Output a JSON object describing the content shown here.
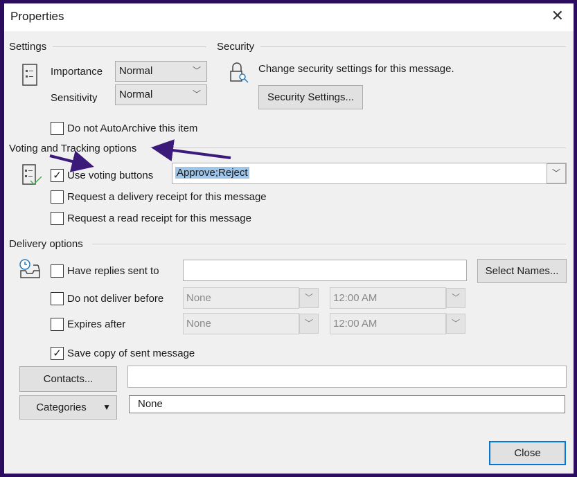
{
  "window": {
    "title": "Properties",
    "close_icon": "close-icon"
  },
  "settings": {
    "heading": "Settings",
    "importance_label": "Importance",
    "importance_value": "Normal",
    "sensitivity_label": "Sensitivity",
    "sensitivity_value": "Normal",
    "autoarchive_label": "Do not AutoArchive this item",
    "autoarchive_checked": false
  },
  "security": {
    "heading": "Security",
    "text": "Change security settings for this message.",
    "button": "Security Settings..."
  },
  "voting": {
    "heading": "Voting and Tracking options",
    "use_voting_label": "Use voting buttons",
    "use_voting_checked": true,
    "voting_value": "Approve;Reject",
    "delivery_receipt_label": "Request a delivery receipt for this message",
    "read_receipt_label": "Request a read receipt for this message"
  },
  "delivery": {
    "heading": "Delivery options",
    "replies_label": "Have replies sent to",
    "replies_value": "",
    "select_names": "Select Names...",
    "not_before_label": "Do not deliver before",
    "not_before_date": "None",
    "not_before_time": "12:00 AM",
    "expires_label": "Expires after",
    "expires_date": "None",
    "expires_time": "12:00 AM",
    "save_copy_label": "Save copy of sent message",
    "save_copy_checked": true
  },
  "contacts": {
    "button": "Contacts...",
    "value": ""
  },
  "categories": {
    "button": "Categories",
    "value": "None"
  },
  "footer": {
    "close": "Close"
  },
  "annotation": {
    "arrow_color": "#3b1a7a"
  }
}
